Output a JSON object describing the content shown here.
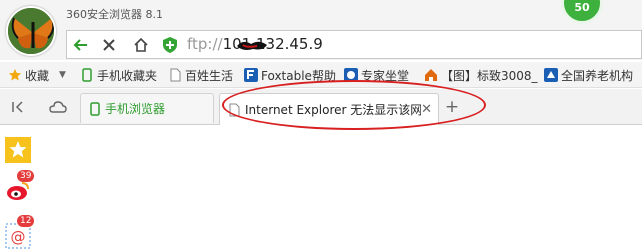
{
  "window": {
    "title": "360安全浏览器 8.1",
    "badge_count": "50"
  },
  "address_bar": {
    "protocol": "ftp://",
    "host": "101.132.45.9"
  },
  "bookmarks": [
    {
      "label": "收藏",
      "icon": "star-icon"
    },
    {
      "label": "手机收藏夹",
      "icon": "phone-icon"
    },
    {
      "label": "百姓生活",
      "icon": "page-icon"
    },
    {
      "label": "Foxtable帮助",
      "icon": "foxtable-icon"
    },
    {
      "label": "专家坐堂",
      "icon": "expert-icon"
    },
    {
      "label": "【图】标致3008_",
      "icon": "home-logo-icon"
    },
    {
      "label": "全国养老机构",
      "icon": "org-icon"
    }
  ],
  "tabs": [
    {
      "label": "手机浏览器",
      "icon": "phone-icon"
    },
    {
      "label": "Internet Explorer 无法显示该网页",
      "icon": "page-icon",
      "active": true
    }
  ],
  "sidebar": [
    {
      "icon": "favorite-star-icon",
      "count": ""
    },
    {
      "icon": "weibo-icon",
      "count": "39"
    },
    {
      "icon": "mail-icon",
      "count": "12"
    }
  ],
  "colors": {
    "accent_green": "#2e9d2e",
    "annotation_red": "#d82020",
    "badge_green": "#3db03d"
  }
}
